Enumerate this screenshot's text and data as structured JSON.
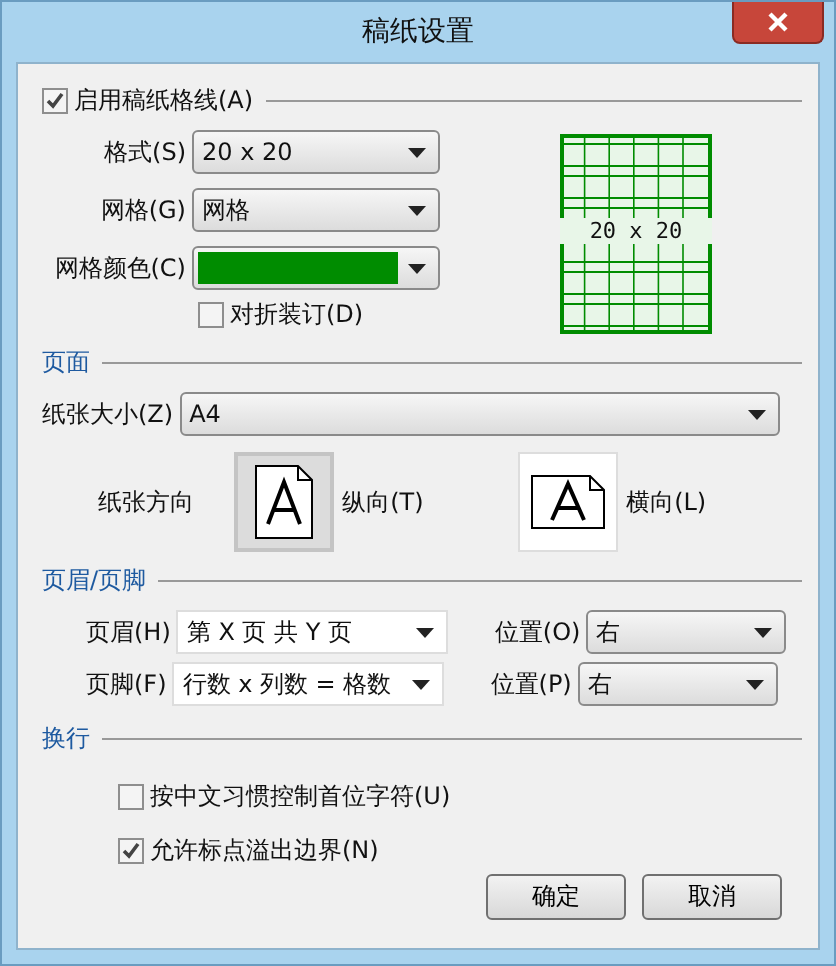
{
  "window": {
    "title": "稿纸设置"
  },
  "gridlines": {
    "label": "启用稿纸格线(A)",
    "checked": true,
    "fields": [
      {
        "kind": "select",
        "label": "格式(S)",
        "value": "20 x 20"
      },
      {
        "kind": "select",
        "label": "网格(G)",
        "value": "网格"
      },
      {
        "kind": "color",
        "label": "网格颜色(C)",
        "color": "#008c00"
      }
    ],
    "fold_binding": {
      "label": "对折装订(D)",
      "checked": false
    },
    "preview": {
      "text": "20 x 20"
    }
  },
  "page": {
    "title": "页面",
    "paper_size": {
      "label": "纸张大小(Z)",
      "value": "A4"
    },
    "orientation": {
      "label": "纸张方向",
      "options": [
        {
          "kind": "portrait",
          "label": "纵向(T)",
          "selected": true
        },
        {
          "kind": "landscape",
          "label": "横向(L)",
          "selected": false
        }
      ]
    }
  },
  "header_footer": {
    "title": "页眉/页脚",
    "rows": [
      {
        "label": "页眉(H)",
        "value": "第 X 页 共 Y 页",
        "position_label": "位置(O)",
        "position": "右"
      },
      {
        "label": "页脚(F)",
        "value": "行数 x 列数 = 格数",
        "position_label": "位置(P)",
        "position": "右"
      }
    ]
  },
  "line_break": {
    "title": "换行",
    "options": [
      {
        "label": "按中文习惯控制首位字符(U)",
        "checked": false
      },
      {
        "label": "允许标点溢出边界(N)",
        "checked": true
      }
    ]
  },
  "buttons": [
    "确定",
    "取消"
  ]
}
